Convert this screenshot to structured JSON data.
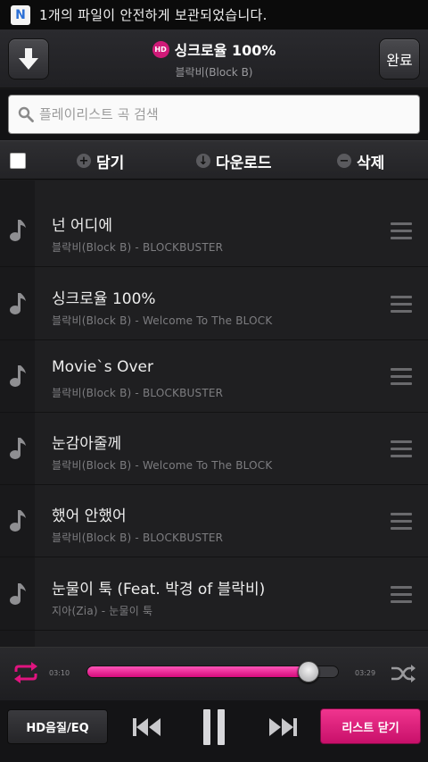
{
  "status_bar": {
    "notification_icon": "N",
    "message": "1개의 파일이 안전하게 보관되었습니다."
  },
  "header": {
    "download_icon": "arrow-down-icon",
    "hd_badge": "HD",
    "song_title": "싱크로율 100%",
    "artist": "블락비(Block B)",
    "done_label": "완료"
  },
  "search": {
    "placeholder": "플레이리스트 곡 검색"
  },
  "actions": {
    "add_label": "담기",
    "download_label": "다운로드",
    "delete_label": "삭제"
  },
  "tracks": [
    {
      "title": "넌 어디에",
      "subtitle": "블락비(Block B) - BLOCKBUSTER"
    },
    {
      "title": "싱크로율 100%",
      "subtitle": "블락비(Block B) - Welcome To The BLOCK"
    },
    {
      "title": "Movie`s Over",
      "subtitle": "블락비(Block B) - BLOCKBUSTER"
    },
    {
      "title": "눈감아줄께",
      "subtitle": "블락비(Block B) - Welcome To The BLOCK"
    },
    {
      "title": "했어 안했어",
      "subtitle": "블락비(Block B) - BLOCKBUSTER"
    },
    {
      "title": "눈물이 툭 (Feat. 박경 of 블락비)",
      "subtitle": "지아(Zia) - 눈물이 툭"
    }
  ],
  "player": {
    "current_time": "03:10",
    "total_time": "03:29",
    "progress_fraction": 0.88,
    "hd_eq_label": "HD음질/EQ",
    "close_list_label": "리스트 닫기"
  },
  "colors": {
    "accent": "#e0147f",
    "background": "#1f1f21"
  }
}
